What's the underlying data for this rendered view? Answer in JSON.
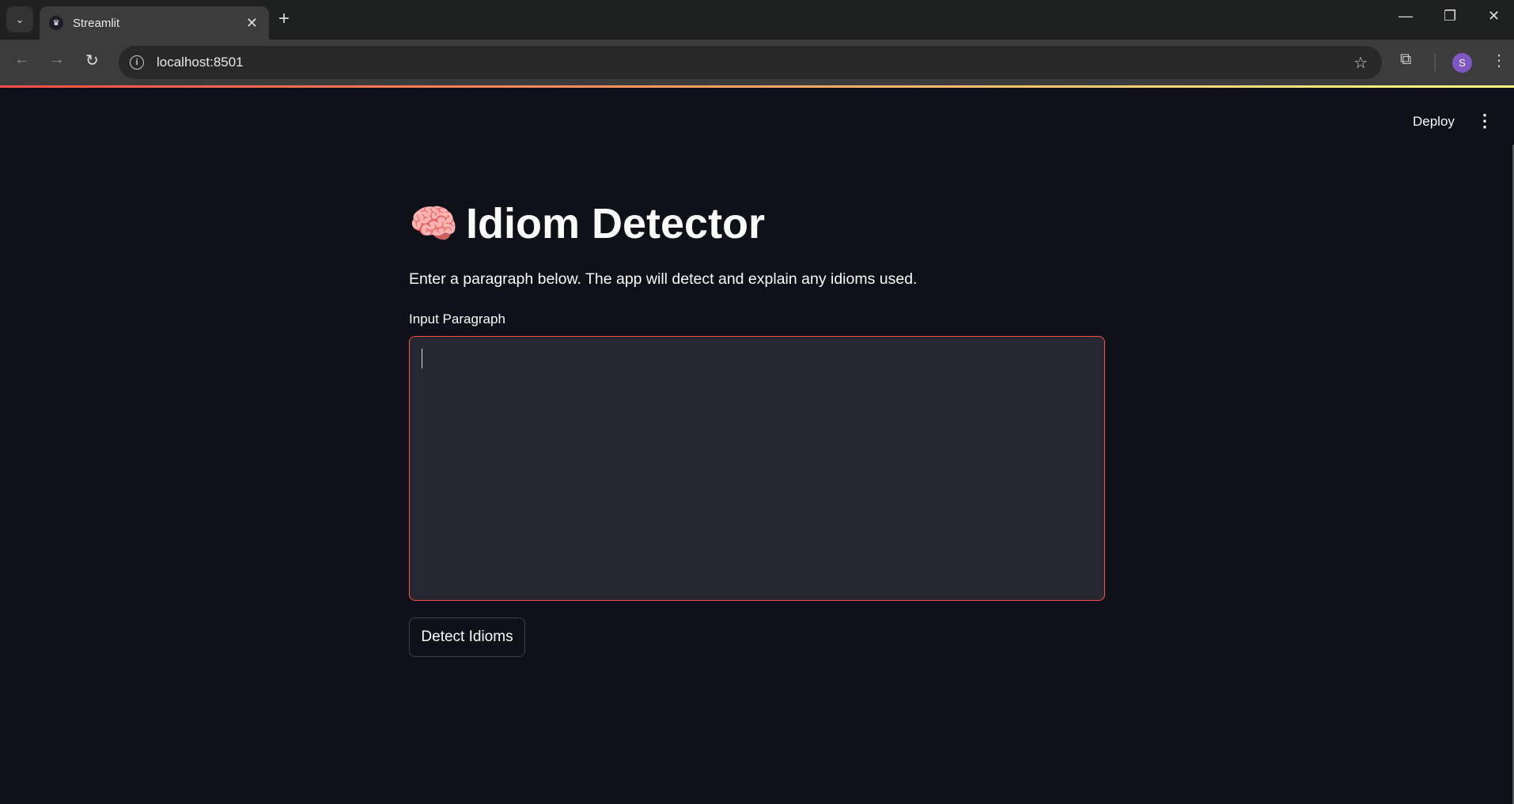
{
  "browser": {
    "tab_title": "Streamlit",
    "url": "localhost:8501",
    "profile_initial": "S",
    "icons": {
      "tab_search": "chevron-down-icon",
      "favicon": "streamlit-crown-icon",
      "back": "arrow-left-icon",
      "forward": "arrow-right-icon",
      "reload": "reload-icon",
      "site_info": "info-icon",
      "bookmark": "star-icon",
      "extensions": "puzzle-icon",
      "menu": "kebab-icon"
    },
    "glyphs": {
      "tab_search": "⌄",
      "favicon": "♛",
      "close": "✕",
      "new_tab": "+",
      "minimize": "—",
      "restore": "❐",
      "window_close": "✕",
      "back": "←",
      "forward": "→",
      "reload": "↻",
      "info": "i",
      "star": "☆",
      "ext": "⧉",
      "menu": "⋮"
    }
  },
  "app": {
    "deploy_label": "Deploy",
    "menu_glyph": "⋮",
    "title_emoji": "🧠",
    "title": "Idiom Detector",
    "description": "Enter a paragraph below. The app will detect and explain any idioms used.",
    "input_label": "Input Paragraph",
    "input_value": "",
    "button_label": "Detect Idioms",
    "colors": {
      "background": "#0e1117",
      "input_bg": "#262730",
      "focus_border": "#ff4b4b",
      "text": "#fafafa"
    }
  }
}
